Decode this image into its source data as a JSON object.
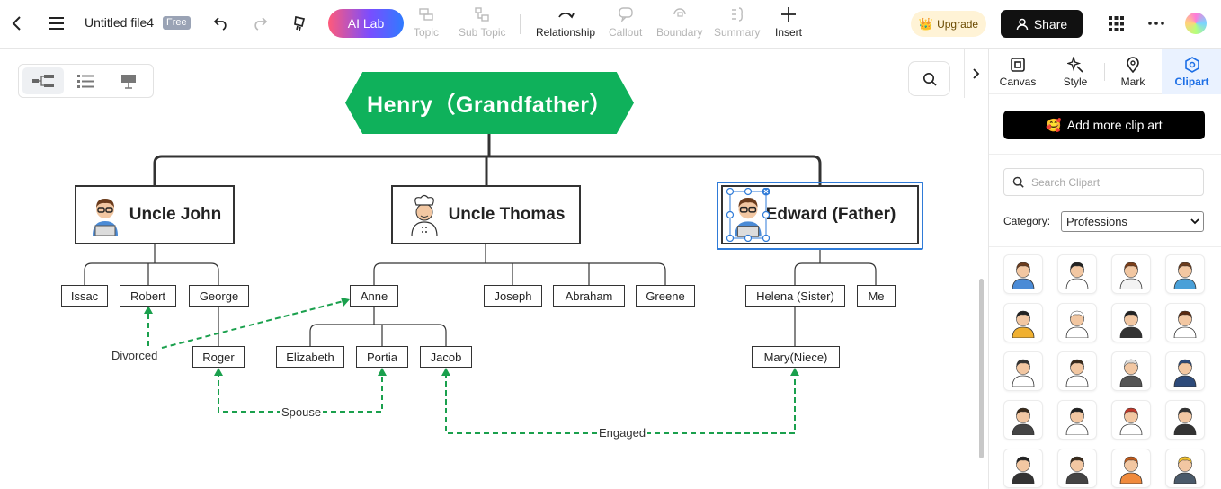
{
  "header": {
    "file_title": "Untitled file4",
    "free_badge": "Free",
    "ai_lab": "AI Lab",
    "tools": {
      "topic": "Topic",
      "subtopic": "Sub Topic",
      "relationship": "Relationship",
      "callout": "Callout",
      "boundary": "Boundary",
      "summary": "Summary",
      "insert": "Insert"
    },
    "upgrade": "Upgrade",
    "share": "Share"
  },
  "diagram": {
    "root": "Henry（Grandfather）",
    "children": [
      {
        "label": "Uncle John",
        "avatar": "man-glasses-laptop-icon",
        "kids": [
          "Issac",
          "Robert",
          "George"
        ]
      },
      {
        "label": "Uncle Thomas",
        "avatar": "chef-icon",
        "kids": [
          "Anne",
          "Joseph",
          "Abraham",
          "Greene"
        ]
      },
      {
        "label": "Edward (Father)",
        "avatar": "man-glasses-laptop-icon",
        "kids": [
          "Helena (Sister)",
          "Me"
        ]
      }
    ],
    "roger": "Roger",
    "anne_kids": [
      "Elizabeth",
      "Portia",
      "Jacob"
    ],
    "mary": "Mary(Niece)",
    "relations": {
      "divorced": "Divorced",
      "spouse": "Spouse",
      "engaged": "Engaged"
    },
    "relation_color": "#1aa04d",
    "root_color": "#0fb15b",
    "selection_color": "#2f7bd8"
  },
  "panel": {
    "tabs": [
      "Canvas",
      "Style",
      "Mark",
      "Clipart"
    ],
    "active_tab": "Clipart",
    "add_more": "Add more clip art",
    "search_placeholder": "Search Clipart",
    "category_label": "Category:",
    "category_value": "Professions",
    "clipart": [
      "man-glasses-laptop-icon",
      "businesswoman-icon",
      "woman-long-hair-icon",
      "woman-bun-icon",
      "basketball-player-icon",
      "chef-icon",
      "graduate-icon",
      "nurse-icon",
      "doctor-icon",
      "woman-doctor-icon",
      "old-man-icon",
      "police-officer-icon",
      "man-suit-icon",
      "man-white-shirt-icon",
      "arab-man-icon",
      "woman-hijab-icon",
      "woman-suit-icon",
      "bearded-man-icon",
      "orange-hair-man-icon",
      "construction-worker-icon"
    ]
  }
}
